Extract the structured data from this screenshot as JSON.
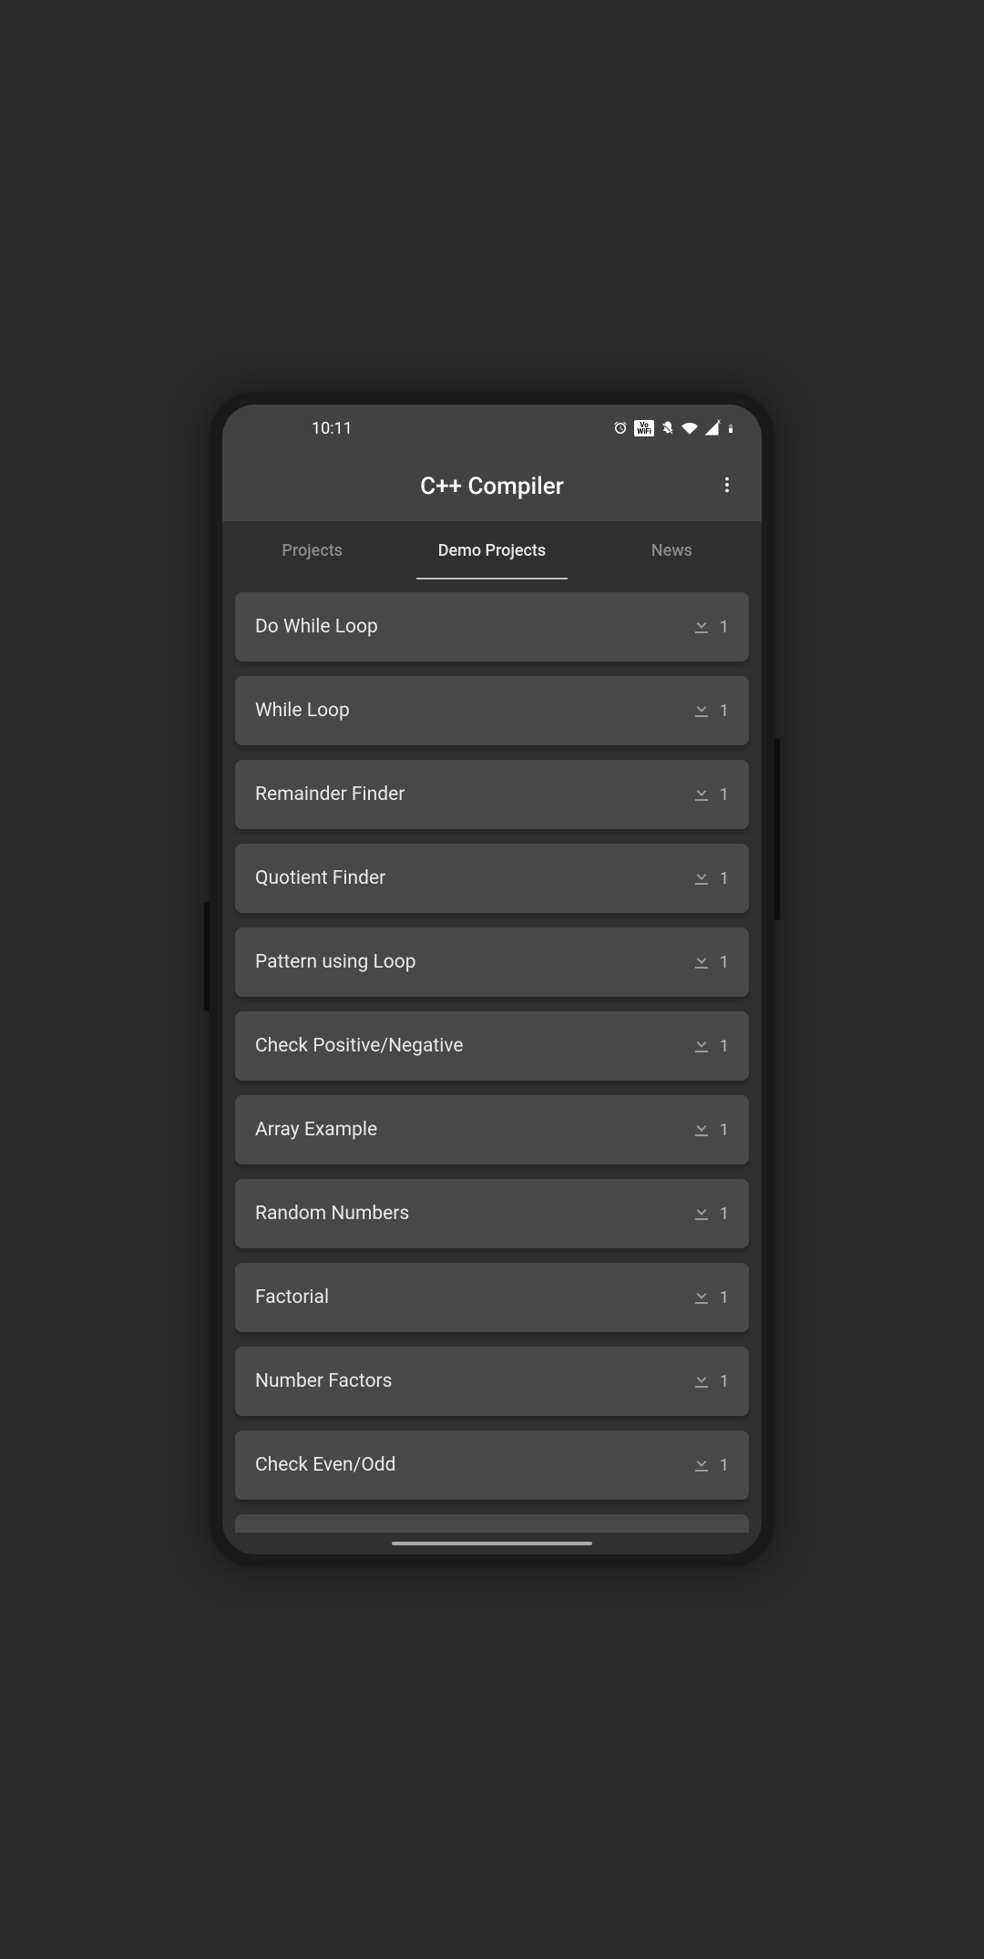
{
  "statusBar": {
    "time": "10:11"
  },
  "appBar": {
    "title": "C++ Compiler"
  },
  "tabs": [
    {
      "label": "Projects",
      "active": false
    },
    {
      "label": "Demo Projects",
      "active": true
    },
    {
      "label": "News",
      "active": false
    }
  ],
  "items": [
    {
      "label": "Do While Loop",
      "count": "1"
    },
    {
      "label": "While Loop",
      "count": "1"
    },
    {
      "label": "Remainder Finder",
      "count": "1"
    },
    {
      "label": "Quotient Finder",
      "count": "1"
    },
    {
      "label": "Pattern using Loop",
      "count": "1"
    },
    {
      "label": "Check Positive/Negative",
      "count": "1"
    },
    {
      "label": "Array Example",
      "count": "1"
    },
    {
      "label": "Random Numbers",
      "count": "1"
    },
    {
      "label": "Factorial",
      "count": "1"
    },
    {
      "label": "Number Factors",
      "count": "1"
    },
    {
      "label": "Check Even/Odd",
      "count": "1"
    }
  ]
}
